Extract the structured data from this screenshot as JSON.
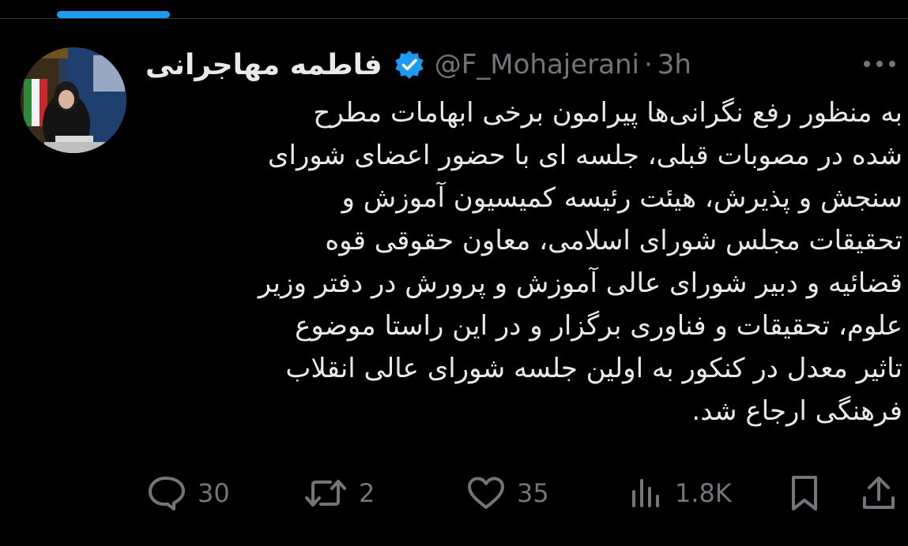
{
  "user": {
    "display_name": "فاطمه مهاجرانی",
    "handle": "@F_Mohajerani",
    "time": "3h",
    "separator": "·"
  },
  "tweet": {
    "lines": [
      "به منظور رفع نگرانی‌ها پیرامون برخی ابهامات مطرح",
      "شده در مصوبات قبلی، جلسه ای با حضور اعضای شورای",
      "سنجش و پذیرش، هیئت رئیسه کمیسیون آموزش و",
      "تحقیقات مجلس شورای اسلامی، معاون حقوقی قوه",
      "قضائیه و دبیر شورای عالی آموزش و پرورش در دفتر وزیر",
      "علوم، تحقیقات و فناوری برگزار و در این راستا موضوع",
      "تاثیر معدل در کنکور به اولین جلسه شورای عالی انقلاب",
      "فرهنگی ارجاع شد."
    ]
  },
  "actions": {
    "replies": "30",
    "reposts": "2",
    "likes": "35",
    "views": "1.8K"
  },
  "colors": {
    "background": "#000000",
    "text": "#e7e9ea",
    "muted": "#71767b",
    "accent": "#1d9bf0",
    "divider": "#2f3336"
  },
  "icons": [
    "more-icon",
    "verified-badge-icon",
    "reply-icon",
    "repost-icon",
    "like-icon",
    "views-icon",
    "bookmark-icon",
    "share-icon"
  ]
}
